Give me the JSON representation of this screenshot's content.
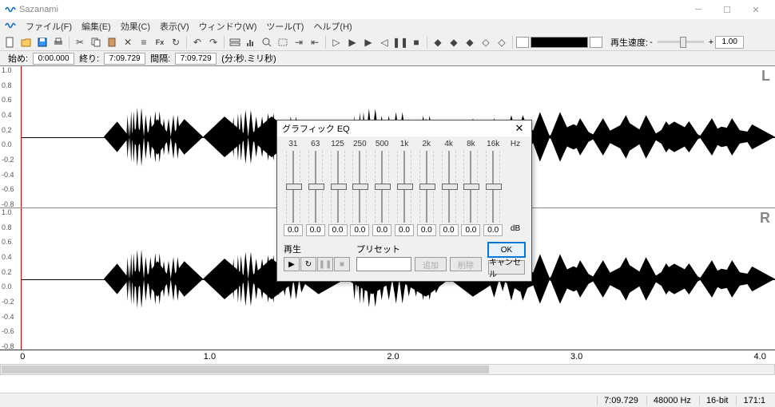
{
  "app": {
    "title": "Sazanami"
  },
  "menu": [
    "ファイル(F)",
    "編集(E)",
    "効果(C)",
    "表示(V)",
    "ウィンドウ(W)",
    "ツール(T)",
    "ヘルプ(H)"
  ],
  "toolbar": {
    "speed_label": "再生速度:",
    "speed_minus": "-",
    "speed_plus": "+",
    "speed_value": "1.00"
  },
  "time": {
    "start_label": "始め:",
    "start_val": "0:00.000",
    "end_label": "終り:",
    "end_val": "7:09.729",
    "range_label": "間隔:",
    "range_val": "7:09.729",
    "unit_label": "(分:秒.ミリ秒)"
  },
  "waveform": {
    "y_ticks": [
      "1.0",
      "0.8",
      "0.6",
      "0.4",
      "0.2",
      "0.0",
      "-0.2",
      "-0.4",
      "-0.6",
      "-0.8"
    ],
    "channels": [
      "L",
      "R"
    ],
    "x_ticks": [
      {
        "pos": 0,
        "label": "0"
      },
      {
        "pos": 24.4,
        "label": "1.0"
      },
      {
        "pos": 48.8,
        "label": "2.0"
      },
      {
        "pos": 73.2,
        "label": "3.0"
      },
      {
        "pos": 97.6,
        "label": "4.0"
      }
    ]
  },
  "status": {
    "duration": "7:09.729",
    "sample_rate": "48000 Hz",
    "bit_depth": "16-bit",
    "other": "171:1"
  },
  "dialog": {
    "title": "グラフィック EQ",
    "hz_label": "Hz",
    "db_label": "dB",
    "bands": [
      {
        "freq": "31",
        "value": "0.0"
      },
      {
        "freq": "63",
        "value": "0.0"
      },
      {
        "freq": "125",
        "value": "0.0"
      },
      {
        "freq": "250",
        "value": "0.0"
      },
      {
        "freq": "500",
        "value": "0.0"
      },
      {
        "freq": "1k",
        "value": "0.0"
      },
      {
        "freq": "2k",
        "value": "0.0"
      },
      {
        "freq": "4k",
        "value": "0.0"
      },
      {
        "freq": "8k",
        "value": "0.0"
      },
      {
        "freq": "16k",
        "value": "0.0"
      }
    ],
    "play_label": "再生",
    "preset_label": "プリセット",
    "add_btn": "追加",
    "del_btn": "削除",
    "ok_btn": "OK",
    "cancel_btn": "キャンセル"
  }
}
